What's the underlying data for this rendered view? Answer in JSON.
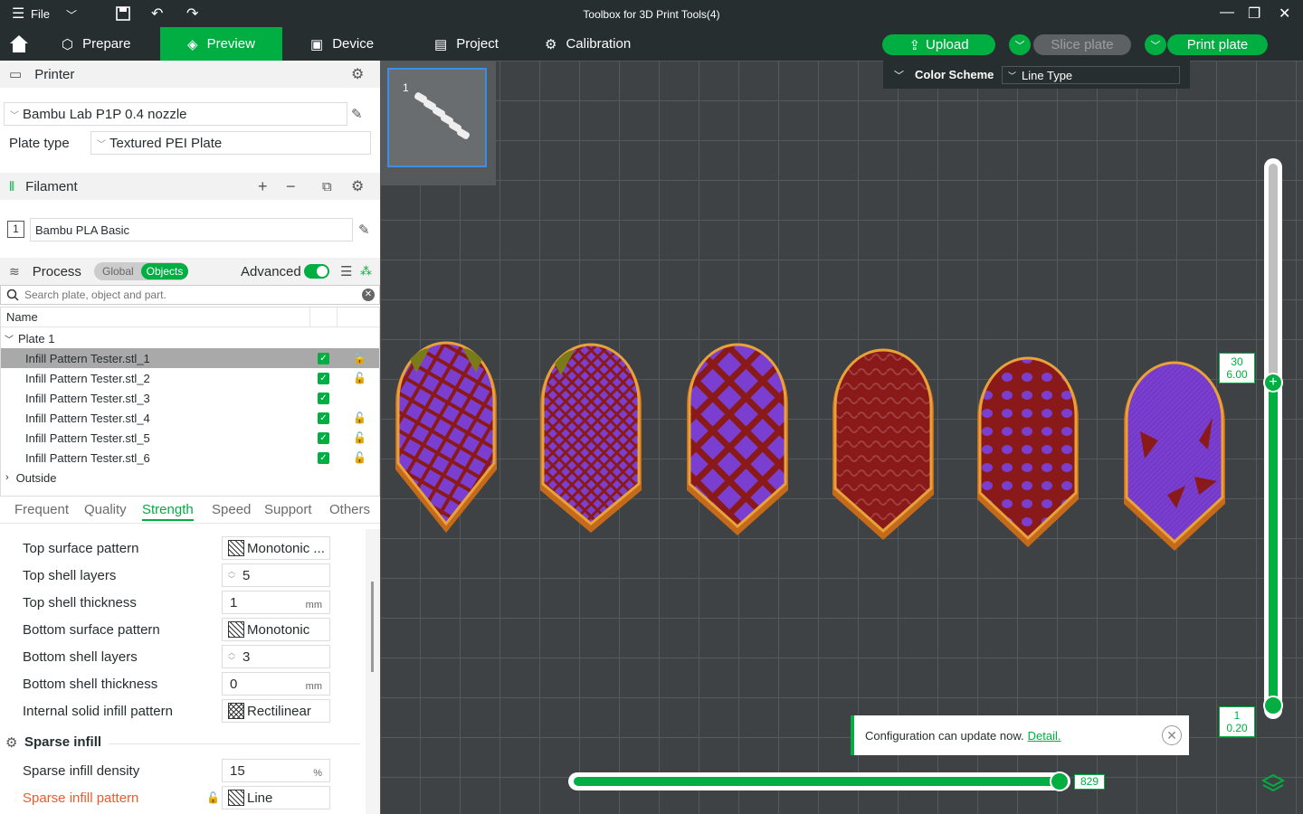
{
  "titlebar": {
    "file_label": "File",
    "title": "Toolbox for 3D Print Tools(4)"
  },
  "nav": {
    "tabs": [
      {
        "label": "Prepare"
      },
      {
        "label": "Preview"
      },
      {
        "label": "Device"
      },
      {
        "label": "Project"
      },
      {
        "label": "Calibration"
      }
    ],
    "upload": "Upload",
    "slice": "Slice plate",
    "print": "Print plate"
  },
  "printer": {
    "header": "Printer",
    "name": "Bambu Lab P1P 0.4 nozzle",
    "plate_label": "Plate type",
    "plate_value": "Textured PEI Plate"
  },
  "filament": {
    "header": "Filament",
    "index": "1",
    "name": "Bambu PLA Basic"
  },
  "process": {
    "header": "Process",
    "global": "Global",
    "objects": "Objects",
    "advanced": "Advanced",
    "search_placeholder": "Search plate, object and part."
  },
  "objects": {
    "col_name": "Name",
    "plate": "Plate 1",
    "items": [
      "Infill Pattern Tester.stl_1",
      "Infill Pattern Tester.stl_2",
      "Infill Pattern Tester.stl_3",
      "Infill Pattern Tester.stl_4",
      "Infill Pattern Tester.stl_5",
      "Infill Pattern Tester.stl_6"
    ],
    "outside": "Outside"
  },
  "param_tabs": [
    "Frequent",
    "Quality",
    "Strength",
    "Speed",
    "Support",
    "Others"
  ],
  "params": {
    "top_surface_pattern": {
      "label": "Top surface pattern",
      "value": "Monotonic ..."
    },
    "top_shell_layers": {
      "label": "Top shell layers",
      "value": "5"
    },
    "top_shell_thickness": {
      "label": "Top shell thickness",
      "value": "1",
      "unit": "mm"
    },
    "bottom_surface_pattern": {
      "label": "Bottom surface pattern",
      "value": "Monotonic"
    },
    "bottom_shell_layers": {
      "label": "Bottom shell layers",
      "value": "3"
    },
    "bottom_shell_thickness": {
      "label": "Bottom shell thickness",
      "value": "0",
      "unit": "mm"
    },
    "internal_solid_infill": {
      "label": "Internal solid infill pattern",
      "value": "Rectilinear"
    },
    "sparse_header": "Sparse infill",
    "sparse_density": {
      "label": "Sparse infill density",
      "value": "15",
      "unit": "%"
    },
    "sparse_pattern": {
      "label": "Sparse infill pattern",
      "value": "Line"
    }
  },
  "viewport": {
    "thumb_index": "1",
    "color_scheme_label": "Color Scheme",
    "color_scheme_value": "Line Type",
    "layer_top": "30",
    "layer_top_height": "6.00",
    "layer_bottom": "1",
    "layer_bottom_height": "0.20",
    "move_value": "829",
    "toast_text": "Configuration can update now.",
    "toast_link": "Detail."
  },
  "colors": {
    "accent": "#00ae42",
    "dark": "#262e30",
    "infill": "#8a1a1a",
    "top": "#7a3fd0",
    "wall": "#e08a1a"
  }
}
